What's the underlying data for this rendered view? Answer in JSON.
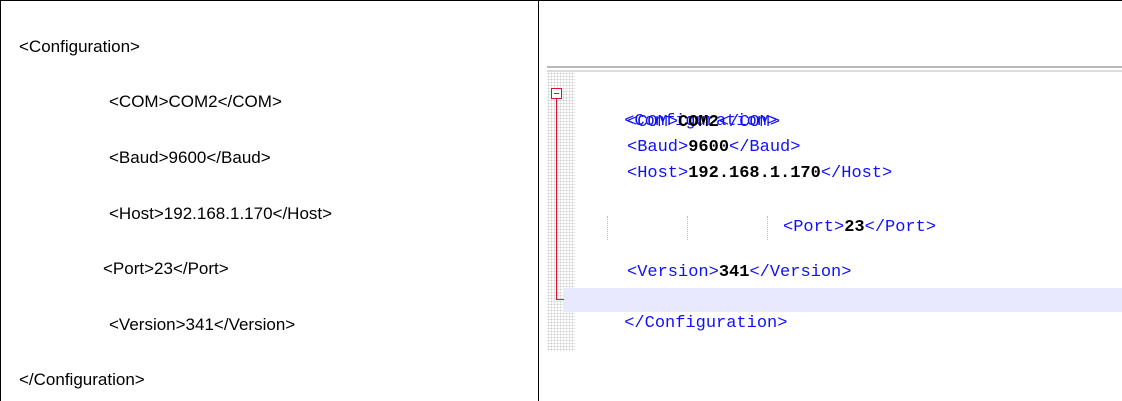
{
  "left_text": [
    "<Configuration>",
    "<COM>COM2</COM>",
    "<Baud>9600</Baud>",
    "<Host>192.168.1.170</Host>",
    "<Port>23</Port>",
    "<Version>341</Version>",
    "</Configuration>"
  ],
  "editor": {
    "root_open": "<Configuration>",
    "com_open": "<COM>",
    "com_val": "COM2",
    "com_close": "</COM>",
    "baud_open": "<Baud>",
    "baud_val": "9600",
    "baud_close": "</Baud>",
    "host_open": "<Host>",
    "host_val": "192.168.1.170",
    "host_close": "</Host>",
    "port_open": "<Port>",
    "port_val": "23",
    "port_close": "</Port>",
    "version_open": "<Version>",
    "version_val": "341",
    "version_close": "</Version>",
    "root_close": "</Configuration>"
  },
  "colors": {
    "tag": "#1010ff",
    "fold_marker": "#e0102a",
    "current_line": "#e8e8ff"
  }
}
